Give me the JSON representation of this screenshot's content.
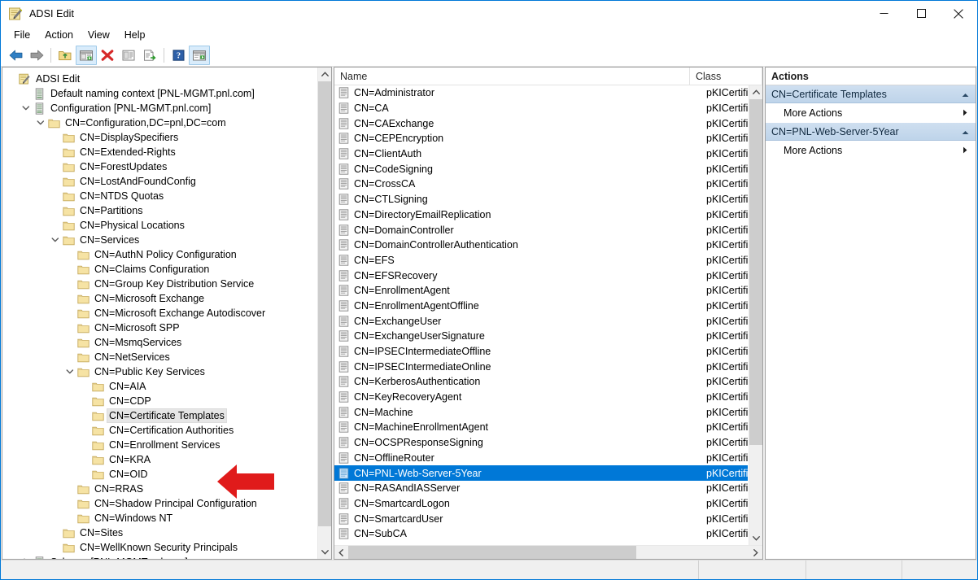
{
  "window": {
    "title": "ADSI Edit",
    "app_icon": "adsi-edit-icon",
    "controls": {
      "minimize": "–",
      "maximize": "□",
      "close": "✕"
    }
  },
  "menubar": {
    "items": [
      "File",
      "Action",
      "View",
      "Help"
    ]
  },
  "toolbar": {
    "buttons": [
      {
        "name": "back-icon",
        "type": "back",
        "active": false
      },
      {
        "name": "forward-icon",
        "type": "forward",
        "active": false
      },
      {
        "name": "separator",
        "type": "sep",
        "active": false
      },
      {
        "name": "up-folder-icon",
        "type": "folder",
        "active": false
      },
      {
        "name": "show-tree-icon",
        "type": "console",
        "active": true
      },
      {
        "name": "delete-icon",
        "type": "delete",
        "active": false
      },
      {
        "name": "properties-icon",
        "type": "props",
        "active": false
      },
      {
        "name": "export-list-icon",
        "type": "export",
        "active": false
      },
      {
        "name": "separator",
        "type": "sep",
        "active": false
      },
      {
        "name": "help-icon",
        "type": "help",
        "active": false
      },
      {
        "name": "show-action-pane-icon",
        "type": "actionpane",
        "active": true
      }
    ]
  },
  "tree": {
    "items": [
      {
        "label": "ADSI Edit",
        "depth": 0,
        "icon": "adsi-root-icon",
        "twisty": "",
        "selected": false
      },
      {
        "label": "Default naming context [PNL-MGMT.pnl.com]",
        "depth": 1,
        "icon": "naming-context-icon",
        "twisty": "",
        "selected": false
      },
      {
        "label": "Configuration [PNL-MGMT.pnl.com]",
        "depth": 1,
        "icon": "naming-context-icon",
        "twisty": "expanded",
        "selected": false
      },
      {
        "label": "CN=Configuration,DC=pnl,DC=com",
        "depth": 2,
        "icon": "folder-icon",
        "twisty": "expanded",
        "selected": false
      },
      {
        "label": "CN=DisplaySpecifiers",
        "depth": 3,
        "icon": "folder-icon",
        "twisty": "",
        "selected": false
      },
      {
        "label": "CN=Extended-Rights",
        "depth": 3,
        "icon": "folder-icon",
        "twisty": "",
        "selected": false
      },
      {
        "label": "CN=ForestUpdates",
        "depth": 3,
        "icon": "folder-icon",
        "twisty": "",
        "selected": false
      },
      {
        "label": "CN=LostAndFoundConfig",
        "depth": 3,
        "icon": "folder-icon",
        "twisty": "",
        "selected": false
      },
      {
        "label": "CN=NTDS Quotas",
        "depth": 3,
        "icon": "folder-icon",
        "twisty": "",
        "selected": false
      },
      {
        "label": "CN=Partitions",
        "depth": 3,
        "icon": "folder-icon",
        "twisty": "",
        "selected": false
      },
      {
        "label": "CN=Physical Locations",
        "depth": 3,
        "icon": "folder-icon",
        "twisty": "",
        "selected": false
      },
      {
        "label": "CN=Services",
        "depth": 3,
        "icon": "folder-icon",
        "twisty": "expanded",
        "selected": false
      },
      {
        "label": "CN=AuthN Policy Configuration",
        "depth": 4,
        "icon": "folder-icon",
        "twisty": "",
        "selected": false
      },
      {
        "label": "CN=Claims Configuration",
        "depth": 4,
        "icon": "folder-icon",
        "twisty": "",
        "selected": false
      },
      {
        "label": "CN=Group Key Distribution Service",
        "depth": 4,
        "icon": "folder-icon",
        "twisty": "",
        "selected": false
      },
      {
        "label": "CN=Microsoft Exchange",
        "depth": 4,
        "icon": "folder-icon",
        "twisty": "",
        "selected": false
      },
      {
        "label": "CN=Microsoft Exchange Autodiscover",
        "depth": 4,
        "icon": "folder-icon",
        "twisty": "",
        "selected": false
      },
      {
        "label": "CN=Microsoft SPP",
        "depth": 4,
        "icon": "folder-icon",
        "twisty": "",
        "selected": false
      },
      {
        "label": "CN=MsmqServices",
        "depth": 4,
        "icon": "folder-icon",
        "twisty": "",
        "selected": false
      },
      {
        "label": "CN=NetServices",
        "depth": 4,
        "icon": "folder-icon",
        "twisty": "",
        "selected": false
      },
      {
        "label": "CN=Public Key Services",
        "depth": 4,
        "icon": "folder-icon",
        "twisty": "expanded",
        "selected": false
      },
      {
        "label": "CN=AIA",
        "depth": 5,
        "icon": "folder-icon",
        "twisty": "",
        "selected": false
      },
      {
        "label": "CN=CDP",
        "depth": 5,
        "icon": "folder-icon",
        "twisty": "",
        "selected": false
      },
      {
        "label": "CN=Certificate Templates",
        "depth": 5,
        "icon": "folder-icon",
        "twisty": "",
        "selected": true
      },
      {
        "label": "CN=Certification Authorities",
        "depth": 5,
        "icon": "folder-icon",
        "twisty": "",
        "selected": false
      },
      {
        "label": "CN=Enrollment Services",
        "depth": 5,
        "icon": "folder-icon",
        "twisty": "",
        "selected": false
      },
      {
        "label": "CN=KRA",
        "depth": 5,
        "icon": "folder-icon",
        "twisty": "",
        "selected": false
      },
      {
        "label": "CN=OID",
        "depth": 5,
        "icon": "folder-icon",
        "twisty": "",
        "selected": false
      },
      {
        "label": "CN=RRAS",
        "depth": 4,
        "icon": "folder-icon",
        "twisty": "",
        "selected": false
      },
      {
        "label": "CN=Shadow Principal Configuration",
        "depth": 4,
        "icon": "folder-icon",
        "twisty": "",
        "selected": false
      },
      {
        "label": "CN=Windows NT",
        "depth": 4,
        "icon": "folder-icon",
        "twisty": "",
        "selected": false
      },
      {
        "label": "CN=Sites",
        "depth": 3,
        "icon": "folder-icon",
        "twisty": "",
        "selected": false
      },
      {
        "label": "CN=WellKnown Security Principals",
        "depth": 3,
        "icon": "folder-icon",
        "twisty": "",
        "selected": false
      },
      {
        "label": "Schema [PNL-MGMT.pnl.com]",
        "depth": 1,
        "icon": "naming-context-icon",
        "twisty": "collapsed",
        "selected": false
      }
    ]
  },
  "list": {
    "columns": [
      "Name",
      "Class"
    ],
    "rows": [
      {
        "name": "CN=Administrator",
        "class": "pKICertificat",
        "selected": false
      },
      {
        "name": "CN=CA",
        "class": "pKICertificat",
        "selected": false
      },
      {
        "name": "CN=CAExchange",
        "class": "pKICertificat",
        "selected": false
      },
      {
        "name": "CN=CEPEncryption",
        "class": "pKICertificat",
        "selected": false
      },
      {
        "name": "CN=ClientAuth",
        "class": "pKICertificat",
        "selected": false
      },
      {
        "name": "CN=CodeSigning",
        "class": "pKICertificat",
        "selected": false
      },
      {
        "name": "CN=CrossCA",
        "class": "pKICertificat",
        "selected": false
      },
      {
        "name": "CN=CTLSigning",
        "class": "pKICertificat",
        "selected": false
      },
      {
        "name": "CN=DirectoryEmailReplication",
        "class": "pKICertificat",
        "selected": false
      },
      {
        "name": "CN=DomainController",
        "class": "pKICertificat",
        "selected": false
      },
      {
        "name": "CN=DomainControllerAuthentication",
        "class": "pKICertificat",
        "selected": false
      },
      {
        "name": "CN=EFS",
        "class": "pKICertificat",
        "selected": false
      },
      {
        "name": "CN=EFSRecovery",
        "class": "pKICertificat",
        "selected": false
      },
      {
        "name": "CN=EnrollmentAgent",
        "class": "pKICertificat",
        "selected": false
      },
      {
        "name": "CN=EnrollmentAgentOffline",
        "class": "pKICertificat",
        "selected": false
      },
      {
        "name": "CN=ExchangeUser",
        "class": "pKICertificat",
        "selected": false
      },
      {
        "name": "CN=ExchangeUserSignature",
        "class": "pKICertificat",
        "selected": false
      },
      {
        "name": "CN=IPSECIntermediateOffline",
        "class": "pKICertificat",
        "selected": false
      },
      {
        "name": "CN=IPSECIntermediateOnline",
        "class": "pKICertificat",
        "selected": false
      },
      {
        "name": "CN=KerberosAuthentication",
        "class": "pKICertificat",
        "selected": false
      },
      {
        "name": "CN=KeyRecoveryAgent",
        "class": "pKICertificat",
        "selected": false
      },
      {
        "name": "CN=Machine",
        "class": "pKICertificat",
        "selected": false
      },
      {
        "name": "CN=MachineEnrollmentAgent",
        "class": "pKICertificat",
        "selected": false
      },
      {
        "name": "CN=OCSPResponseSigning",
        "class": "pKICertificat",
        "selected": false
      },
      {
        "name": "CN=OfflineRouter",
        "class": "pKICertificat",
        "selected": false
      },
      {
        "name": "CN=PNL-Web-Server-5Year",
        "class": "pKICertificat",
        "selected": true
      },
      {
        "name": "CN=RASAndIASServer",
        "class": "pKICertificat",
        "selected": false
      },
      {
        "name": "CN=SmartcardLogon",
        "class": "pKICertificat",
        "selected": false
      },
      {
        "name": "CN=SmartcardUser",
        "class": "pKICertificat",
        "selected": false
      },
      {
        "name": "CN=SubCA",
        "class": "pKICertificat",
        "selected": false
      }
    ]
  },
  "actions": {
    "title": "Actions",
    "groups": [
      {
        "header": "CN=Certificate Templates",
        "items": [
          "More Actions"
        ]
      },
      {
        "header": "CN=PNL-Web-Server-5Year",
        "items": [
          "More Actions"
        ]
      }
    ]
  },
  "statusbar": {
    "cells": [
      "",
      "",
      "",
      ""
    ]
  },
  "annotation": {
    "type": "arrow-left",
    "color": "#e01b1b",
    "points_to": "CN=Certificate Templates"
  },
  "colors": {
    "selection_blue": "#0078d7",
    "actions_header": "#c3d6ea",
    "annotation_red": "#e01b1b",
    "window_border": "#0078d7"
  }
}
